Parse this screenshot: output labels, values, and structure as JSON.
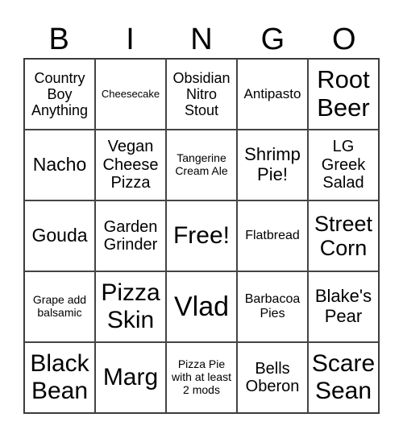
{
  "header": {
    "letters": [
      "B",
      "I",
      "N",
      "G",
      "O"
    ]
  },
  "card": {
    "cells": [
      "Country Boy Anything",
      "Cheesecake",
      "Obsidian Nitro Stout",
      "Antipasto",
      "Root Beer",
      "Nacho",
      "Vegan Cheese Pizza",
      "Tangerine Cream Ale",
      "Shrimp Pie!",
      "LG Greek Salad",
      "Gouda",
      "Garden Grinder",
      "Free!",
      "Flatbread",
      "Street Corn",
      "Grape add balsamic",
      "Pizza Skin",
      "Vlad",
      "Barbacoa Pies",
      "Blake's Pear",
      "Black Bean",
      "Marg",
      "Pizza Pie with at least 2 mods",
      "Bells Oberon",
      "Scare Sean"
    ]
  }
}
